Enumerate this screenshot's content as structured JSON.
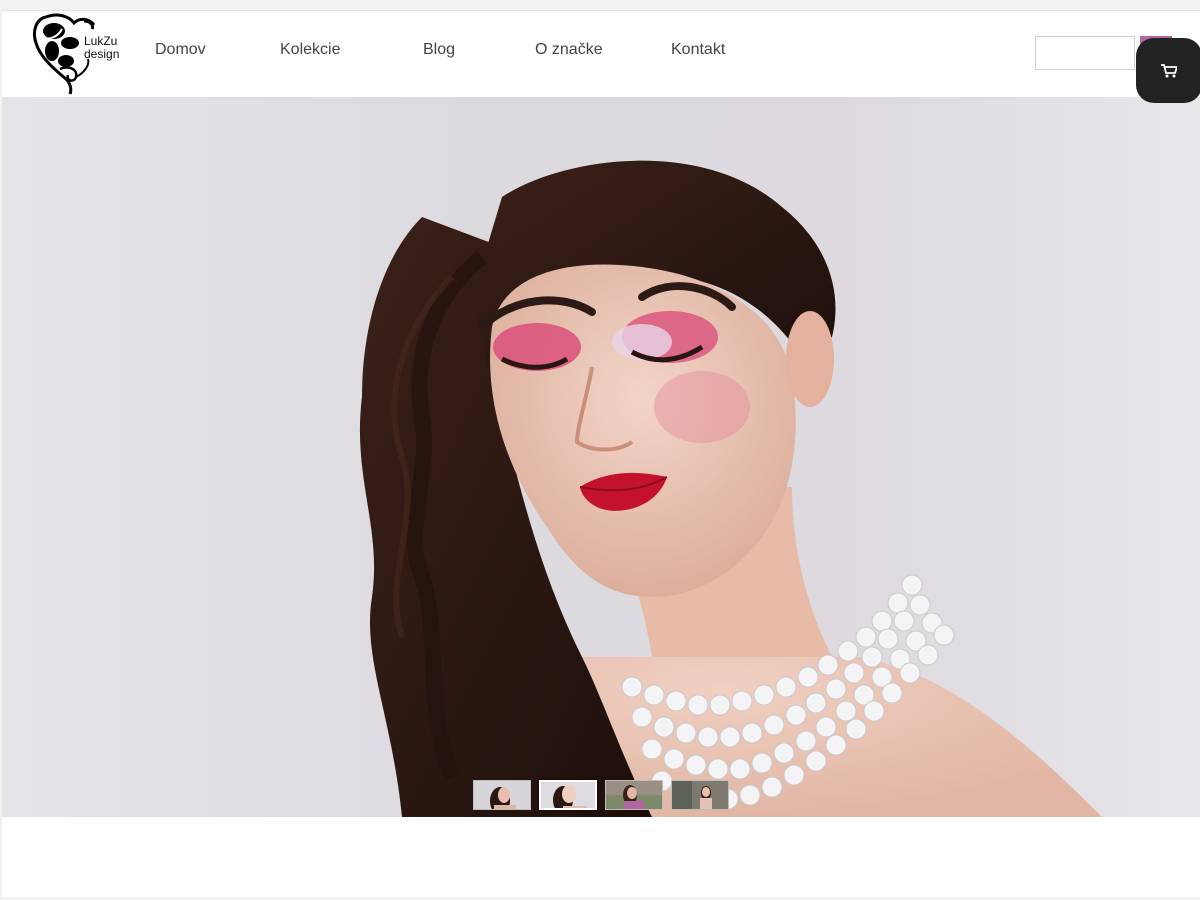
{
  "brand": {
    "name_line1": "LukZu",
    "name_line2": "design"
  },
  "nav": {
    "items": [
      {
        "label": "Domov"
      },
      {
        "label": "Kolekcie"
      },
      {
        "label": "Blog"
      },
      {
        "label": "O značke"
      },
      {
        "label": "Kontakt"
      }
    ]
  },
  "search": {
    "value": "",
    "placeholder": ""
  },
  "icons": {
    "search": "search-icon",
    "cart": "cart-icon"
  },
  "colors": {
    "accent": "#b0679f",
    "cart_bg": "#222222"
  },
  "slider": {
    "thumbnail_count": 4,
    "active_index": 1
  }
}
